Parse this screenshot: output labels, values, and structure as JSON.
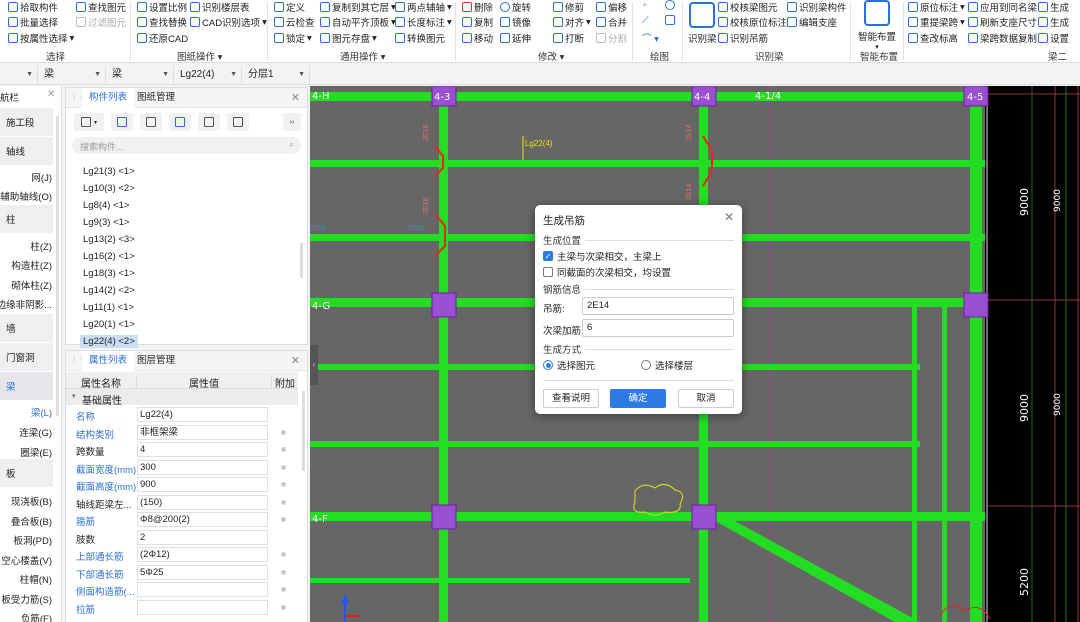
{
  "ribbon": {
    "groups": [
      {
        "label": "选择",
        "items": [
          "拾取构件",
          "批量选择",
          "按属性选择",
          "查找图元",
          "过滤图元"
        ]
      },
      {
        "label": "图纸操作",
        "items": [
          "设置比例",
          "查找替换",
          "还原CAD",
          "识别楼层表",
          "CAD识别选项"
        ]
      },
      {
        "label": "通用操作",
        "items": [
          "定义",
          "云检查",
          "锁定",
          "复制到其它层",
          "自动平齐顶板",
          "图元存盘",
          "两点辅轴",
          "长度标注",
          "转换图元"
        ]
      },
      {
        "label": "修改",
        "items": [
          "删除",
          "复制",
          "移动",
          "旋转",
          "镜像",
          "延伸",
          "修剪",
          "对齐",
          "打断",
          "偏移",
          "合并",
          "分割"
        ]
      },
      {
        "label": "绘图"
      },
      {
        "label": "识别梁",
        "items": [
          "识别梁",
          "校核梁图元",
          "校核原位标注",
          "识别吊筋",
          "识别梁构件",
          "编辑支座"
        ]
      },
      {
        "label": "智能布置",
        "items": [
          "智能布置"
        ]
      },
      {
        "label": "梁二",
        "items": [
          "原位标注",
          "重提梁跨",
          "查改标高",
          "应用到同名梁",
          "刷新支座尺寸",
          "梁跨数据复制",
          "生成",
          "生成",
          "设置"
        ]
      }
    ]
  },
  "selectors": [
    "",
    "梁",
    "梁",
    "Lg22(4)",
    "分层1"
  ],
  "nav": {
    "title": "航栏",
    "headers": [
      "施工段",
      "轴线",
      "柱",
      "墙",
      "门窗洞",
      "梁",
      "板"
    ],
    "subs": [
      "网(J)",
      "辅助轴线(O)",
      "柱(Z)",
      "构造柱(Z)",
      "砌体柱(Z)",
      "剪力墙边缘非阴影...",
      "梁(L)",
      "连梁(G)",
      "圈梁(E)",
      "现浇板(B)",
      "叠合板(B)",
      "板洞(PD)",
      "空心楼盖(V)",
      "柱帽(N)",
      "板受力筋(S)",
      "负筋(F)"
    ]
  },
  "component_panel": {
    "tabs": [
      "构件列表",
      "图纸管理"
    ],
    "search_placeholder": "搜索构件...",
    "items": [
      "Lg21(3) <1>",
      "Lg10(3) <2>",
      "Lg8(4) <1>",
      "Lg9(3) <1>",
      "Lg13(2) <3>",
      "Lg16(2) <1>",
      "Lg18(3) <1>",
      "Lg14(2) <2>",
      "Lg11(1) <1>",
      "Lg20(1) <1>",
      "Lg22(4) <2>"
    ],
    "selected_index": 10
  },
  "property_panel": {
    "tabs": [
      "属性列表",
      "图层管理"
    ],
    "headers": [
      "属性名称",
      "属性值",
      "附加"
    ],
    "section": "基础属性",
    "rows": [
      {
        "name": "名称",
        "value": "Lg22(4)"
      },
      {
        "name": "结构类别",
        "value": "非框架梁"
      },
      {
        "name": "跨数量",
        "value": "4"
      },
      {
        "name": "截面宽度(mm)",
        "value": "300"
      },
      {
        "name": "截面高度(mm)",
        "value": "900"
      },
      {
        "name": "轴线距梁左...",
        "value": "(150)"
      },
      {
        "name": "箍筋",
        "value": "Φ8@200(2)"
      },
      {
        "name": "肢数",
        "value": "2"
      },
      {
        "name": "上部通长筋",
        "value": "(2Φ12)"
      },
      {
        "name": "下部通长筋",
        "value": "5Φ25"
      },
      {
        "name": "侧面构造筋(...",
        "value": ""
      },
      {
        "name": "拉筋",
        "value": ""
      }
    ]
  },
  "cad": {
    "axes": [
      "4-H",
      "4-3",
      "4-4",
      "4-1/4",
      "4-5",
      "4-G",
      "4-F"
    ],
    "beam_label": "Lg22(4)",
    "dims": [
      "9000",
      "9000",
      "9000",
      "9000",
      "5200"
    ],
    "annotations": [
      "2E18",
      "2E18",
      "2E14",
      "2E14",
      "2E22",
      "2E20"
    ]
  },
  "dialog": {
    "title": "生成吊筋",
    "section_position": "生成位置",
    "opt1": "主梁与次梁相交，主梁上",
    "opt1_checked": true,
    "opt2": "同截面的次梁相交，均设置",
    "opt2_checked": false,
    "section_rebar": "钢筋信息",
    "hanger_label": "吊筋:",
    "hanger_value": "2E14",
    "extra_label": "次梁加筋:",
    "extra_value": "6",
    "section_method": "生成方式",
    "radio1": "选择图元",
    "radio2": "选择楼层",
    "selected_method": "选择图元",
    "btn_help": "查看说明",
    "btn_ok": "确定",
    "btn_cancel": "取消"
  },
  "colors": {
    "accent": "#2c7be5",
    "beam": "#22dd22",
    "column": "#9933cc",
    "canvas": "#666666"
  }
}
